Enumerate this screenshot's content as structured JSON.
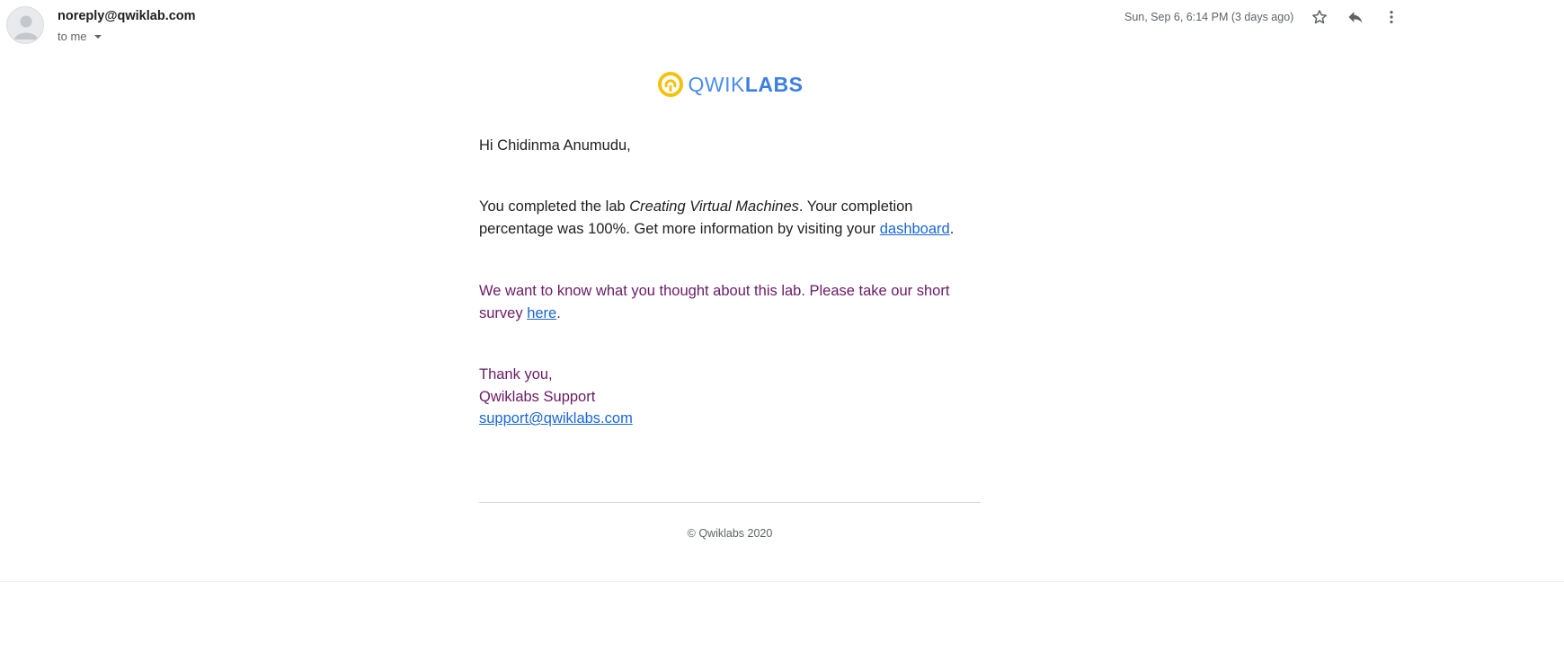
{
  "header": {
    "sender": "noreply@qwiklab.com",
    "recipient_label": "to me",
    "timestamp": "Sun, Sep 6, 6:14 PM (3 days ago)",
    "icons": {
      "avatar": "person-icon",
      "star": "star-icon",
      "reply": "reply-icon",
      "more": "more-vert-icon"
    }
  },
  "logo": {
    "word_light": "QWIK",
    "word_bold": "LABS",
    "colors": {
      "ring": "#f4c20d",
      "text": "#4b8df0"
    }
  },
  "body": {
    "greeting": "Hi Chidinma Anumudu,",
    "completion_pre": "You completed the lab ",
    "lab_name": "Creating Virtual Machines",
    "completion_post": ". Your completion percentage was 100%. Get more information by visiting your ",
    "dashboard_link": "dashboard",
    "completion_end": ".",
    "survey_pre": "We want to know what you thought about this lab. Please take our short survey ",
    "survey_link": "here",
    "survey_end": ".",
    "thanks": "Thank you,",
    "signature": "Qwiklabs Support",
    "support_email": "support@qwiklabs.com"
  },
  "footer": {
    "copyright": "© Qwiklabs 2020"
  },
  "colors": {
    "link": "#1a66d6",
    "purple_text": "#6a1b65",
    "muted": "#5f6368"
  }
}
